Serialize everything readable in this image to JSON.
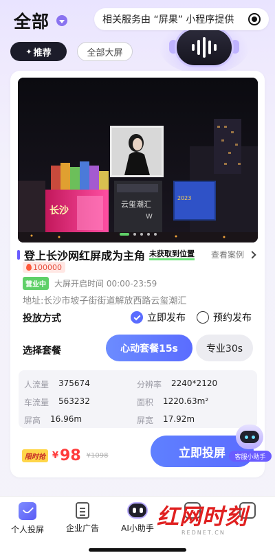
{
  "header": {
    "title": "全部",
    "mini_program_text": "相关服务由 “屏果” 小程序提供"
  },
  "tabs": [
    {
      "label": "推荐"
    },
    {
      "label": "全部大屏"
    }
  ],
  "card": {
    "name": "登上长沙网红屏成为主角",
    "location_tag": "未获取到位置",
    "case_link": "查看案例",
    "heat": "100000",
    "open_status": "营业中",
    "hours": "大屏开启时间 00:00-23:59",
    "address": "地址:长沙市坡子街街道解放西路云玺潮汇",
    "method_label": "投放方式",
    "methods": [
      {
        "label": "立即发布",
        "checked": true
      },
      {
        "label": "预约发布",
        "checked": false
      }
    ],
    "package_label": "选择套餐",
    "packages": [
      {
        "label": "心动套餐15s",
        "selected": true
      },
      {
        "label": "专业30s",
        "selected": false
      }
    ],
    "stats": [
      {
        "key": "人流量",
        "value": "375674"
      },
      {
        "key": "分辨率",
        "value": "2240*2120"
      },
      {
        "key": "车流量",
        "value": "563232"
      },
      {
        "key": "面积",
        "value": "1220.63m²"
      },
      {
        "key": "屏高",
        "value": "16.96m"
      },
      {
        "key": "屏宽",
        "value": "17.92m"
      }
    ],
    "flash_badge": "限时抢",
    "currency": "¥",
    "price": "98",
    "original_price": "¥1098",
    "cast_button": "立即投屏",
    "carousel": {
      "count": 5,
      "active": 0
    }
  },
  "helper_label": "客服小助手",
  "nav": [
    {
      "label": "个人投屏",
      "icon": "personal-cast-icon"
    },
    {
      "label": "企业广告",
      "icon": "enterprise-ad-icon"
    },
    {
      "label": "AI小助手",
      "icon": "ai-assistant-icon"
    },
    {
      "label": "",
      "icon": "nav-fourth-icon"
    },
    {
      "label": "",
      "icon": "nav-fifth-icon"
    }
  ],
  "watermark": {
    "main": "红网时刻",
    "sub": "REDNET.CN"
  },
  "colors": {
    "accent": "#5a6cff",
    "price": "#ff3c3c",
    "open": "#5fd068"
  }
}
